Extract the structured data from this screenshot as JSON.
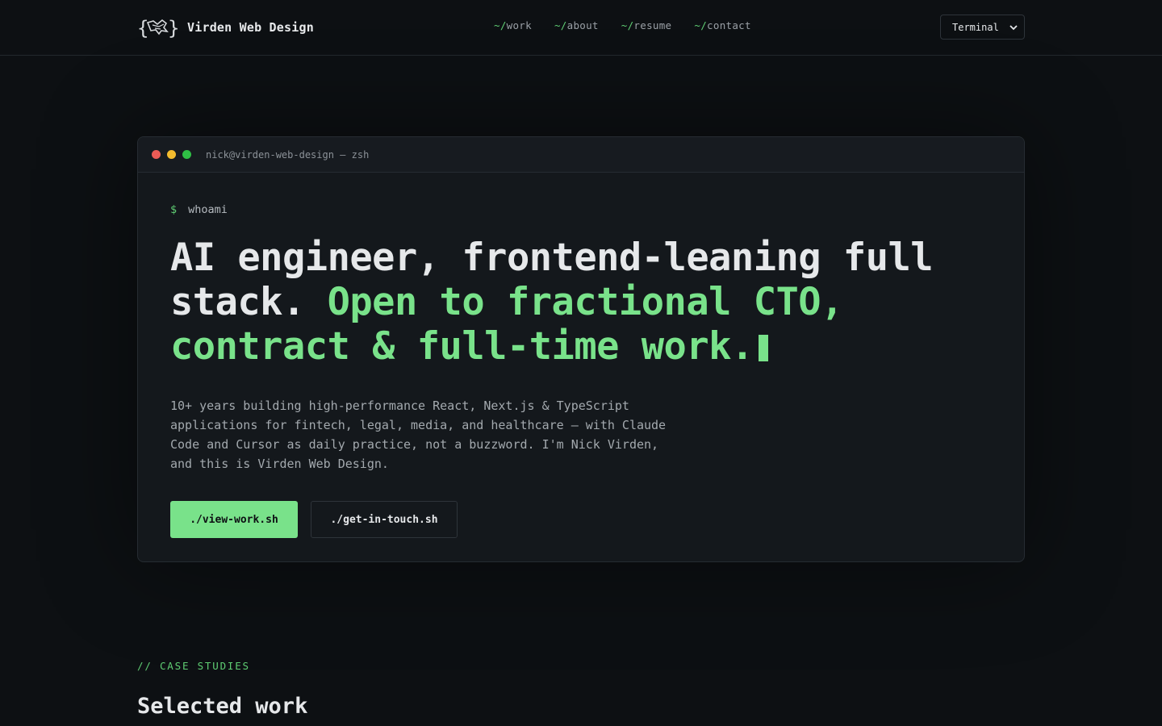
{
  "header": {
    "brand_name": "Virden Web Design",
    "logo_icon": "curly-brace-bird-logo",
    "nav": [
      {
        "prefix": "~/",
        "label": "work"
      },
      {
        "prefix": "~/",
        "label": "about"
      },
      {
        "prefix": "~/",
        "label": "resume"
      },
      {
        "prefix": "~/",
        "label": "contact"
      }
    ],
    "theme_select_value": "Terminal"
  },
  "terminal": {
    "title": "nick@virden-web-design — zsh",
    "prompt_sigil": "$",
    "command": "whoami",
    "headline_plain": "AI engineer, frontend-leaning full stack. ",
    "headline_accent": "Open to fractional CTO, contract & full-time work.",
    "description": "10+ years building high-performance React, Next.js & TypeScript applications for fintech, legal, media, and healthcare — with Claude Code and Cursor as daily practice, not a buzzword. I'm Nick Virden, and this is Virden Web Design.",
    "primary_button": "./view-work.sh",
    "secondary_button": "./get-in-touch.sh"
  },
  "section": {
    "kicker": "// CASE STUDIES",
    "title": "Selected work"
  },
  "colors": {
    "background": "#0d1013",
    "accent": "#79e28a",
    "terminal_bg": "#14181c"
  }
}
